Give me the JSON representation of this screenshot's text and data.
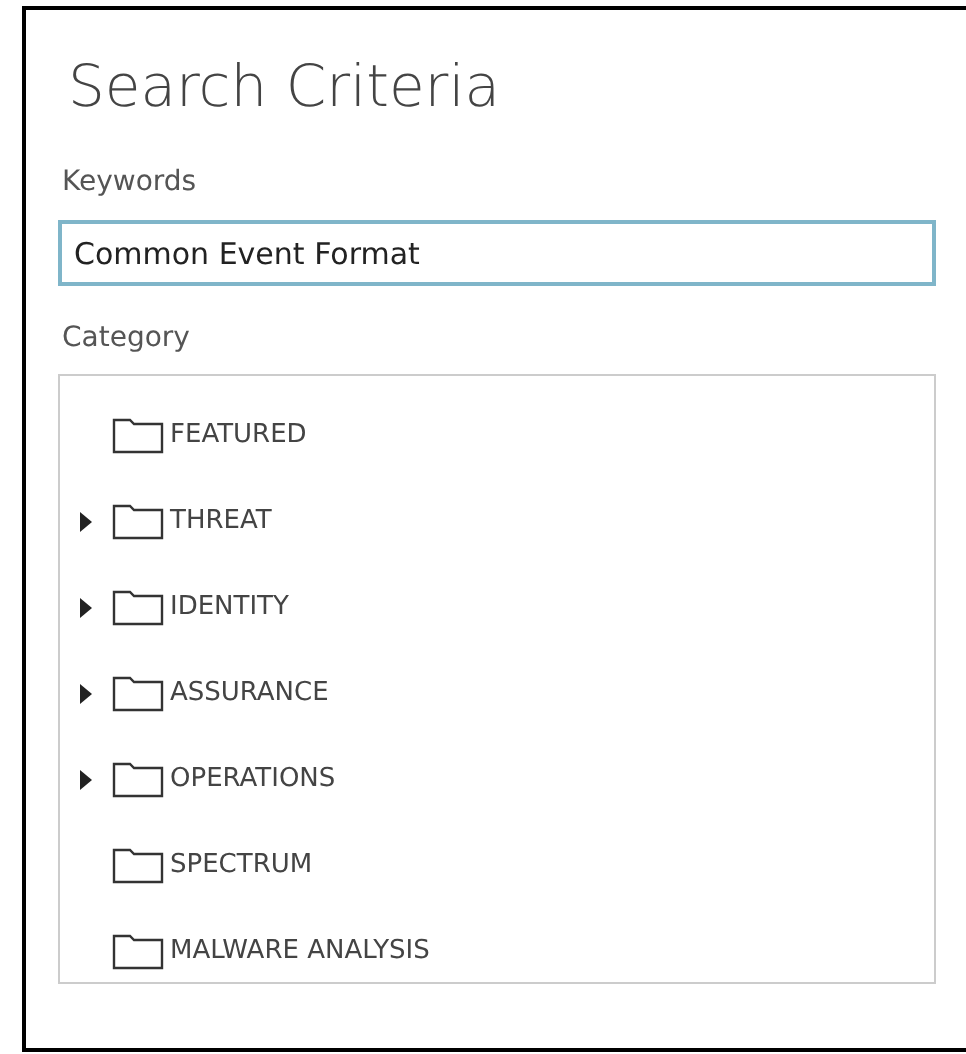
{
  "title": "Search Criteria",
  "keywords": {
    "label": "Keywords",
    "value": "Common Event Format"
  },
  "category": {
    "label": "Category",
    "items": [
      {
        "label": "FEATURED",
        "expandable": false
      },
      {
        "label": "THREAT",
        "expandable": true
      },
      {
        "label": "IDENTITY",
        "expandable": true
      },
      {
        "label": "ASSURANCE",
        "expandable": true
      },
      {
        "label": "OPERATIONS",
        "expandable": true
      },
      {
        "label": "SPECTRUM",
        "expandable": false
      },
      {
        "label": "MALWARE ANALYSIS",
        "expandable": false
      }
    ]
  }
}
